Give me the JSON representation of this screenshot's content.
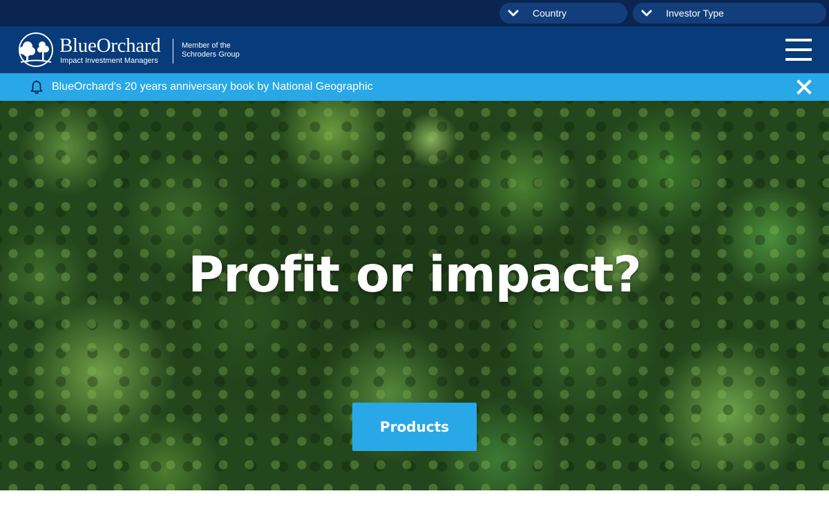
{
  "utility_bar": {
    "country_label": "Country",
    "investor_type_label": "Investor Type"
  },
  "header": {
    "brand_name": "BlueOrchard",
    "brand_tagline": "Impact Investment Managers",
    "member_line1": "Member of the",
    "member_line2": "Schroders Group",
    "menu_icon": "hamburger-menu-icon"
  },
  "announcement": {
    "icon": "bell-icon",
    "text": "BlueOrchard's 20 years anniversary book by National Geographic",
    "close_icon": "close-icon"
  },
  "hero": {
    "title": "Profit or impact?",
    "cta_label": "Products"
  },
  "colors": {
    "utility_bar_bg": "#0b2550",
    "header_bg": "#073b7a",
    "accent_blue": "#29a8e8"
  }
}
